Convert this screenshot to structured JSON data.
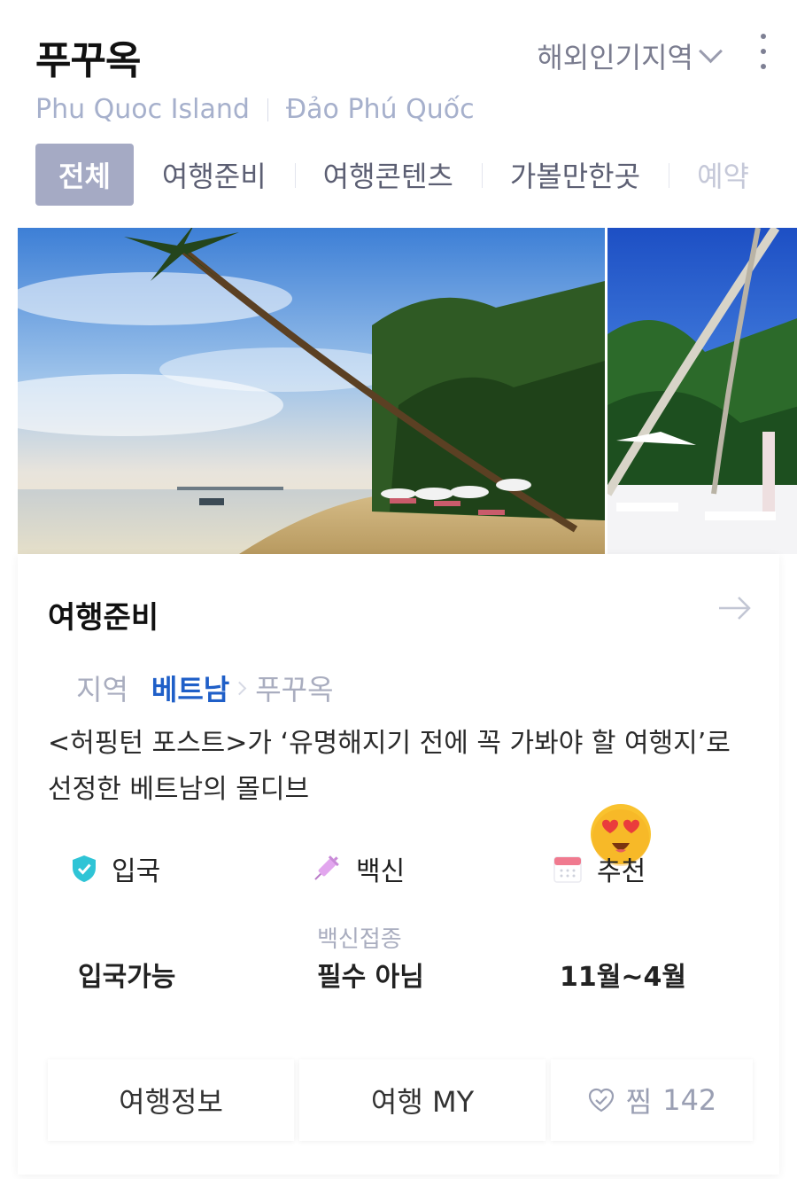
{
  "header": {
    "title": "푸꾸옥",
    "region_selector": "해외인기지역",
    "subtitle_en": "Phu Quoc Island",
    "subtitle_vi": "Đảo Phú Quốc"
  },
  "tabs": [
    {
      "label": "전체",
      "active": true
    },
    {
      "label": "여행준비",
      "active": false
    },
    {
      "label": "여행콘텐츠",
      "active": false
    },
    {
      "label": "가볼만한곳",
      "active": false
    },
    {
      "label": "예약",
      "active": false
    }
  ],
  "prep": {
    "title": "여행준비",
    "breadcrumb": {
      "region": "지역",
      "country": "베트남",
      "city": "푸꾸옥"
    },
    "description": "<허핑턴 포스트>가 ‘유명해지기 전에 꼭 가봐야 할 여행지’로 선정한 베트남의 몰디브",
    "entry": {
      "label": "입국",
      "value": "입국가능"
    },
    "vaccine": {
      "label": "백신",
      "sub": "백신접종",
      "value": "필수 아님"
    },
    "recommend": {
      "label": "추천",
      "value": "11월~4월"
    }
  },
  "actions": {
    "info": "여행정보",
    "my": "여행 MY",
    "like_label": "찜",
    "like_count": "142"
  },
  "colors": {
    "active_tab": "#a5aac4",
    "country_link": "#1f5fc8",
    "subtitle": "#a6b0cc"
  },
  "icons": {
    "entry": "shield-check-icon",
    "vaccine": "syringe-icon",
    "recommend": "calendar-icon",
    "like": "heart-check-icon",
    "more": "more-vertical-icon",
    "arrow": "arrow-right-icon"
  }
}
